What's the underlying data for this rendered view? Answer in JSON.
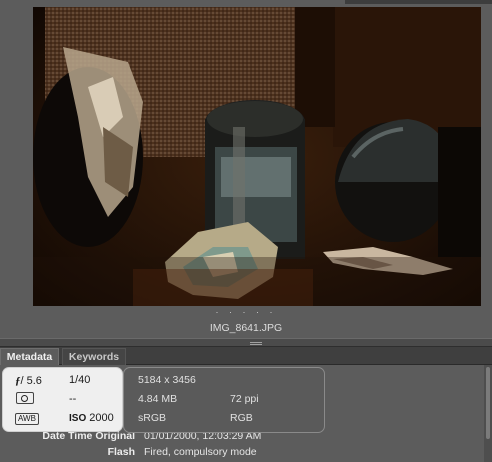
{
  "preview": {
    "filename": "IMG_8641.JPG",
    "dots": "· · · · ·"
  },
  "tabs": [
    {
      "label": "Metadata",
      "active": true
    },
    {
      "label": "Keywords",
      "active": false
    }
  ],
  "camera": {
    "aperture_symbol": "ƒ",
    "aperture": "/ 5.6",
    "shutter": "1/40",
    "metering_icon": "metering-icon",
    "exposure_comp": "--",
    "wb_icon": "AWB",
    "iso_label": "ISO",
    "iso_value": "2000"
  },
  "file_info": {
    "dimensions": "5184 x 3456",
    "size": "4.84 MB",
    "resolution": "72 ppi",
    "color_profile": "sRGB",
    "color_mode": "RGB"
  },
  "metadata_rows": [
    {
      "label": "Date Time Original",
      "value": "01/01/2000, 12:03:29 AM"
    },
    {
      "label": "Flash",
      "value": "Fired, compulsory mode"
    }
  ]
}
